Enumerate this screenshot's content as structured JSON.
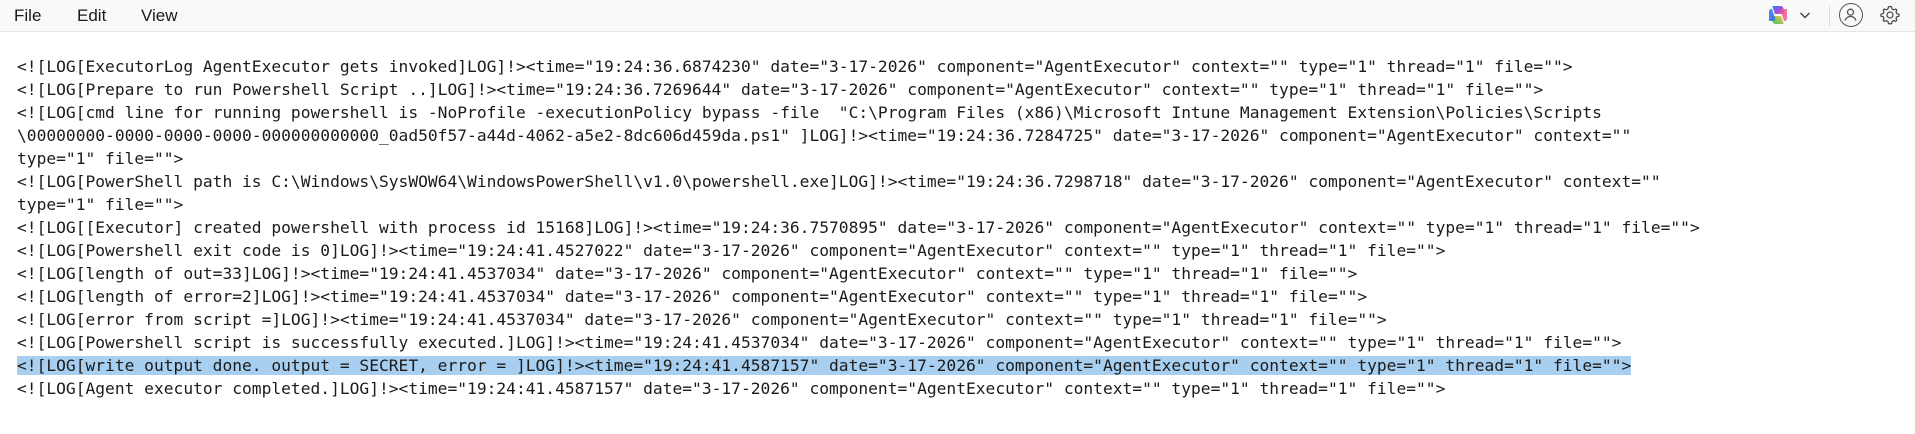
{
  "menu": {
    "file": "File",
    "edit": "Edit",
    "view": "View"
  },
  "toolbar": {
    "icons": [
      "copilot-icon",
      "chevron-down-icon",
      "account-icon",
      "settings-gear-icon"
    ]
  },
  "colors": {
    "selection": "#a8cff0",
    "menubar_bg": "#f9f9f9"
  },
  "log_lines": [
    "<![LOG[ExecutorLog AgentExecutor gets invoked]LOG]!><time=\"19:24:36.6874230\" date=\"3-17-2026\" component=\"AgentExecutor\" context=\"\" type=\"1\" thread=\"1\" file=\"\">",
    "<![LOG[Prepare to run Powershell Script ..]LOG]!><time=\"19:24:36.7269644\" date=\"3-17-2026\" component=\"AgentExecutor\" context=\"\" type=\"1\" thread=\"1\" file=\"\">",
    "<![LOG[cmd line for running powershell is -NoProfile -executionPolicy bypass -file  \"C:\\Program Files (x86)\\Microsoft Intune Management Extension\\Policies\\Scripts",
    "\\00000000-0000-0000-0000-000000000000_0ad50f57-a44d-4062-a5e2-8dc606d459da.ps1\" ]LOG]!><time=\"19:24:36.7284725\" date=\"3-17-2026\" component=\"AgentExecutor\" context=\"\"",
    "type=\"1\" file=\"\">",
    "<![LOG[PowerShell path is C:\\Windows\\SysWOW64\\WindowsPowerShell\\v1.0\\powershell.exe]LOG]!><time=\"19:24:36.7298718\" date=\"3-17-2026\" component=\"AgentExecutor\" context=\"\"",
    "type=\"1\" file=\"\">",
    "<![LOG[[Executor] created powershell with process id 15168]LOG]!><time=\"19:24:36.7570895\" date=\"3-17-2026\" component=\"AgentExecutor\" context=\"\" type=\"1\" thread=\"1\" file=\"\">",
    "<![LOG[Powershell exit code is 0]LOG]!><time=\"19:24:41.4527022\" date=\"3-17-2026\" component=\"AgentExecutor\" context=\"\" type=\"1\" thread=\"1\" file=\"\">",
    "<![LOG[length of out=33]LOG]!><time=\"19:24:41.4537034\" date=\"3-17-2026\" component=\"AgentExecutor\" context=\"\" type=\"1\" thread=\"1\" file=\"\">",
    "<![LOG[length of error=2]LOG]!><time=\"19:24:41.4537034\" date=\"3-17-2026\" component=\"AgentExecutor\" context=\"\" type=\"1\" thread=\"1\" file=\"\">",
    "<![LOG[error from script =]LOG]!><time=\"19:24:41.4537034\" date=\"3-17-2026\" component=\"AgentExecutor\" context=\"\" type=\"1\" thread=\"1\" file=\"\">",
    "<![LOG[Powershell script is successfully executed.]LOG]!><time=\"19:24:41.4537034\" date=\"3-17-2026\" component=\"AgentExecutor\" context=\"\" type=\"1\" thread=\"1\" file=\"\">",
    "<![LOG[write output done. output = SECRET, error = ]LOG]!><time=\"19:24:41.4587157\" date=\"3-17-2026\" component=\"AgentExecutor\" context=\"\" type=\"1\" thread=\"1\" file=\"\">",
    "<![LOG[Agent executor completed.]LOG]!><time=\"19:24:41.4587157\" date=\"3-17-2026\" component=\"AgentExecutor\" context=\"\" type=\"1\" thread=\"1\" file=\"\">"
  ],
  "selected_line": 13
}
